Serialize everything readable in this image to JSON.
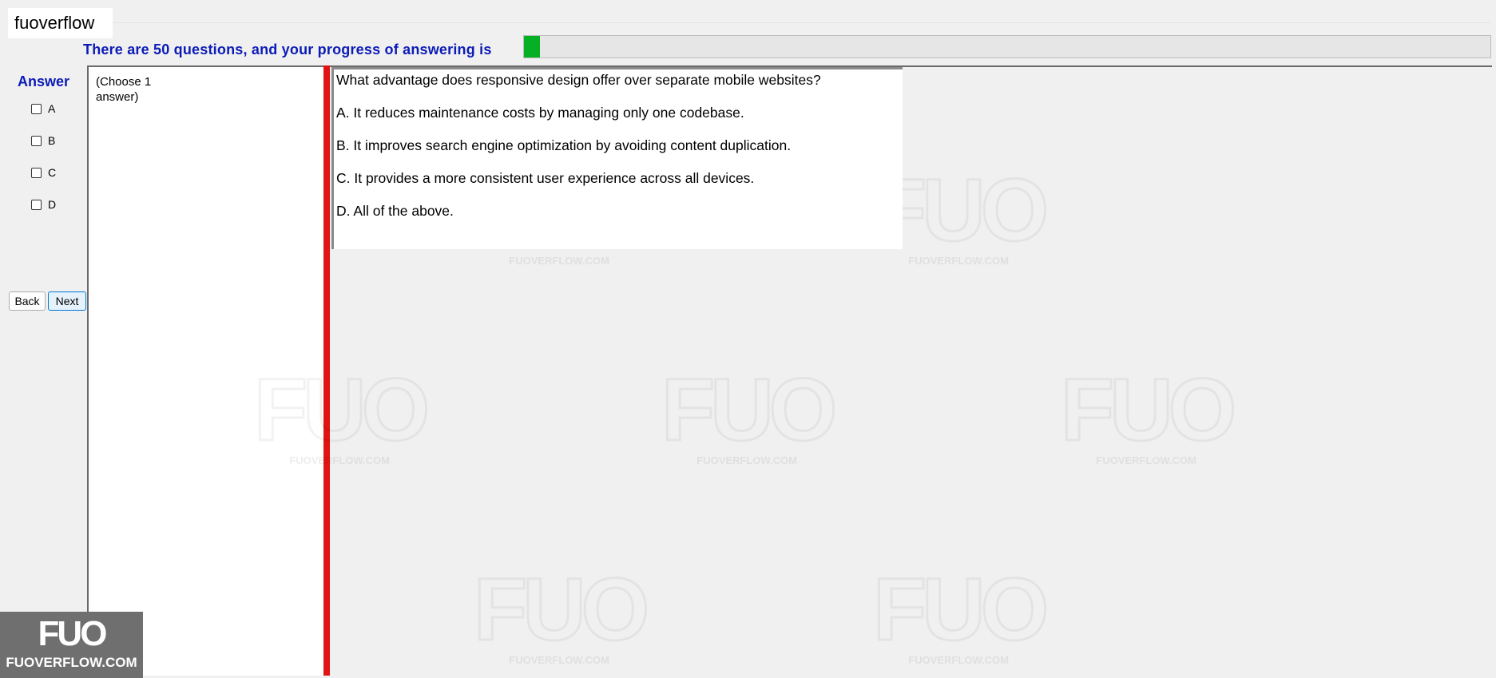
{
  "window": {
    "title": "fuoverflow"
  },
  "progress": {
    "label": "There are 50 questions, and your progress of answering is",
    "fraction": 0.0165,
    "fill_color": "#06b025"
  },
  "answer_panel": {
    "heading": "Answer",
    "options": [
      "A",
      "B",
      "C",
      "D"
    ]
  },
  "nav": {
    "back_label": "Back",
    "next_label": "Next"
  },
  "hint": "(Choose 1 answer)",
  "question": {
    "text": "What advantage does responsive design offer over separate mobile websites?",
    "options": [
      "A.  It reduces maintenance costs by managing only one codebase.",
      "B.  It improves search engine optimization by avoiding content duplication.",
      "C.  It provides a more consistent user experience across all devices.",
      "D.  All of the above."
    ]
  },
  "watermark": {
    "logo": "FUO",
    "site": "FUOVERFLOW.COM"
  },
  "colors": {
    "heading_blue": "#0b1bb7",
    "divider_red": "#e01414",
    "progress_green": "#06b025"
  }
}
